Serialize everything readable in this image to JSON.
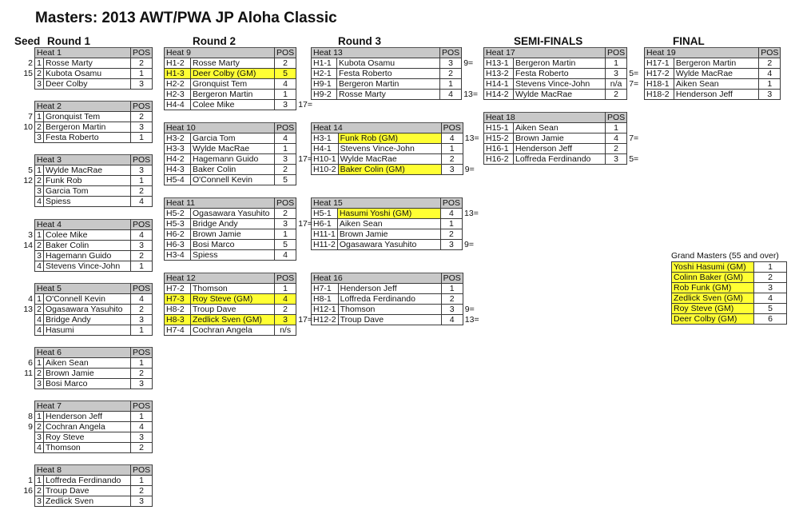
{
  "title": "Masters:  2013 AWT/PWA JP Aloha Classic",
  "headers": {
    "seed": "Seed",
    "round1": "Round 1",
    "round2": "Round 2",
    "round3": "Round 3",
    "semis": "SEMI-FINALS",
    "final": "FINAL"
  },
  "pos_label": "POS",
  "round1": [
    {
      "heat": "Heat 1",
      "rows": [
        {
          "seed": "2",
          "num": "1",
          "name": "Rosse Marty",
          "pos": "2"
        },
        {
          "seed": "15",
          "num": "2",
          "name": "Kubota Osamu",
          "pos": "1"
        },
        {
          "seed": "",
          "num": "3",
          "name": "Deer Colby",
          "pos": "3"
        }
      ]
    },
    {
      "heat": "Heat 2",
      "rows": [
        {
          "seed": "7",
          "num": "1",
          "name": "Gronquist Tem",
          "pos": "2"
        },
        {
          "seed": "10",
          "num": "2",
          "name": "Bergeron Martin",
          "pos": "3"
        },
        {
          "seed": "",
          "num": "3",
          "name": "Festa Roberto",
          "pos": "1"
        }
      ]
    },
    {
      "heat": "Heat 3",
      "rows": [
        {
          "seed": "5",
          "num": "1",
          "name": "Wylde MacRae",
          "pos": "3"
        },
        {
          "seed": "12",
          "num": "2",
          "name": "Funk Rob",
          "pos": "1"
        },
        {
          "seed": "",
          "num": "3",
          "name": "Garcia Tom",
          "pos": "2"
        },
        {
          "seed": "",
          "num": "4",
          "name": "Spiess",
          "pos": "4"
        }
      ]
    },
    {
      "heat": "Heat 4",
      "rows": [
        {
          "seed": "3",
          "num": "1",
          "name": "Colee Mike",
          "pos": "4"
        },
        {
          "seed": "14",
          "num": "2",
          "name": "Baker Colin",
          "pos": "3"
        },
        {
          "seed": "",
          "num": "3",
          "name": "Hagemann Guido",
          "pos": "2"
        },
        {
          "seed": "",
          "num": "4",
          "name": "Stevens Vince-John",
          "pos": "1"
        }
      ]
    },
    {
      "heat": "Heat 5",
      "rows": [
        {
          "seed": "4",
          "num": "1",
          "name": "O'Connell Kevin",
          "pos": "4"
        },
        {
          "seed": "13",
          "num": "2",
          "name": "Ogasawara Yasuhito",
          "pos": "2"
        },
        {
          "seed": "",
          "num": "4",
          "name": "Bridge Andy",
          "pos": "3"
        },
        {
          "seed": "",
          "num": "4",
          "name": "Hasumi",
          "pos": "1"
        }
      ]
    },
    {
      "heat": "Heat 6",
      "rows": [
        {
          "seed": "6",
          "num": "1",
          "name": "Aiken Sean",
          "pos": "1"
        },
        {
          "seed": "11",
          "num": "2",
          "name": "Brown Jamie",
          "pos": "2"
        },
        {
          "seed": "",
          "num": "3",
          "name": "Bosi Marco",
          "pos": "3"
        }
      ]
    },
    {
      "heat": "Heat 7",
      "rows": [
        {
          "seed": "8",
          "num": "1",
          "name": "Henderson Jeff",
          "pos": "1"
        },
        {
          "seed": "9",
          "num": "2",
          "name": "Cochran Angela",
          "pos": "4"
        },
        {
          "seed": "",
          "num": "3",
          "name": "Roy Steve",
          "pos": "3"
        },
        {
          "seed": "",
          "num": "4",
          "name": "Thomson",
          "pos": "2"
        }
      ]
    },
    {
      "heat": "Heat 8",
      "rows": [
        {
          "seed": "1",
          "num": "1",
          "name": "Loffreda Ferdinando",
          "pos": "1"
        },
        {
          "seed": "16",
          "num": "2",
          "name": "Troup Dave",
          "pos": "2"
        },
        {
          "seed": "",
          "num": "3",
          "name": "Zedlick Sven",
          "pos": "3"
        }
      ]
    }
  ],
  "round2": [
    {
      "heat": "Heat 9",
      "rows": [
        {
          "code": "H1-2",
          "name": "Rosse Marty",
          "pos": "2",
          "gm": false,
          "note": ""
        },
        {
          "code": "H1-3",
          "name": "Deer Colby (GM)",
          "pos": "5",
          "gm": true,
          "note": ""
        },
        {
          "code": "H2-2",
          "name": "Gronquist Tem",
          "pos": "4",
          "gm": false,
          "note": ""
        },
        {
          "code": "H2-3",
          "name": "Bergeron Martin",
          "pos": "1",
          "gm": false,
          "note": ""
        },
        {
          "code": "H4-4",
          "name": "Colee Mike",
          "pos": "3",
          "gm": false,
          "note": "17="
        }
      ]
    },
    {
      "heat": "Heat 10",
      "rows": [
        {
          "code": "H3-2",
          "name": "Garcia Tom",
          "pos": "4",
          "gm": false,
          "note": ""
        },
        {
          "code": "H3-3",
          "name": "Wylde MacRae",
          "pos": "1",
          "gm": false,
          "note": ""
        },
        {
          "code": "H4-2",
          "name": "Hagemann Guido",
          "pos": "3",
          "gm": false,
          "note": "17="
        },
        {
          "code": "H4-3",
          "name": "Baker Colin",
          "pos": "2",
          "gm": false,
          "note": ""
        },
        {
          "code": "H5-4",
          "name": "O'Connell Kevin",
          "pos": "5",
          "gm": false,
          "note": ""
        }
      ]
    },
    {
      "heat": "Heat 11",
      "rows": [
        {
          "code": "H5-2",
          "name": "Ogasawara Yasuhito",
          "pos": "2",
          "gm": false,
          "note": ""
        },
        {
          "code": "H5-3",
          "name": "Bridge Andy",
          "pos": "3",
          "gm": false,
          "note": "17="
        },
        {
          "code": "H6-2",
          "name": "Brown Jamie",
          "pos": "1",
          "gm": false,
          "note": ""
        },
        {
          "code": "H6-3",
          "name": "Bosi Marco",
          "pos": "5",
          "gm": false,
          "note": ""
        },
        {
          "code": "H3-4",
          "name": "Spiess",
          "pos": "4",
          "gm": false,
          "note": ""
        }
      ]
    },
    {
      "heat": "Heat 12",
      "rows": [
        {
          "code": "H7-2",
          "name": "Thomson",
          "pos": "1",
          "gm": false,
          "note": ""
        },
        {
          "code": "H7-3",
          "name": "Roy Steve (GM)",
          "pos": "4",
          "gm": true,
          "note": ""
        },
        {
          "code": "H8-2",
          "name": "Troup Dave",
          "pos": "2",
          "gm": false,
          "note": ""
        },
        {
          "code": "H8-3",
          "name": "Zedlick Sven (GM)",
          "pos": "3",
          "gm": true,
          "note": "17="
        },
        {
          "code": "H7-4",
          "name": "Cochran Angela",
          "pos": "n/s",
          "gm": false,
          "note": ""
        }
      ]
    }
  ],
  "round3": [
    {
      "heat": "Heat 13",
      "rows": [
        {
          "code": "H1-1",
          "name": "Kubota Osamu",
          "pos": "3",
          "gm": false,
          "note": "9="
        },
        {
          "code": "H2-1",
          "name": "Festa Roberto",
          "pos": "2",
          "gm": false,
          "note": ""
        },
        {
          "code": "H9-1",
          "name": "Bergeron Martin",
          "pos": "1",
          "gm": false,
          "note": ""
        },
        {
          "code": "H9-2",
          "name": "Rosse Marty",
          "pos": "4",
          "gm": false,
          "note": "13="
        }
      ]
    },
    {
      "heat": "Heat 14",
      "rows": [
        {
          "code": "H3-1",
          "name": "Funk Rob (GM)",
          "pos": "4",
          "gm": true,
          "note": "13="
        },
        {
          "code": "H4-1",
          "name": "Stevens Vince-John",
          "pos": "1",
          "gm": false,
          "note": ""
        },
        {
          "code": "H10-1",
          "name": "Wylde MacRae",
          "pos": "2",
          "gm": false,
          "note": ""
        },
        {
          "code": "H10-2",
          "name": "Baker Colin (GM)",
          "pos": "3",
          "gm": true,
          "note": "9="
        }
      ]
    },
    {
      "heat": "Heat 15",
      "rows": [
        {
          "code": "H5-1",
          "name": "Hasumi Yoshi (GM)",
          "pos": "4",
          "gm": true,
          "note": "13="
        },
        {
          "code": "H6-1",
          "name": "Aiken Sean",
          "pos": "1",
          "gm": false,
          "note": ""
        },
        {
          "code": "H11-1",
          "name": "Brown Jamie",
          "pos": "2",
          "gm": false,
          "note": ""
        },
        {
          "code": "H11-2",
          "name": "Ogasawara Yasuhito",
          "pos": "3",
          "gm": false,
          "note": "9="
        }
      ]
    },
    {
      "heat": "Heat 16",
      "rows": [
        {
          "code": "H7-1",
          "name": "Henderson Jeff",
          "pos": "1",
          "gm": false,
          "note": ""
        },
        {
          "code": "H8-1",
          "name": "Loffreda Ferdinando",
          "pos": "2",
          "gm": false,
          "note": ""
        },
        {
          "code": "H12-1",
          "name": "Thomson",
          "pos": "3",
          "gm": false,
          "note": "9="
        },
        {
          "code": "H12-2",
          "name": "Troup Dave",
          "pos": "4",
          "gm": false,
          "note": "13="
        }
      ]
    }
  ],
  "semis": [
    {
      "heat": "Heat 17",
      "rows": [
        {
          "code": "H13-1",
          "name": "Bergeron Martin",
          "pos": "1",
          "gm": false,
          "note": ""
        },
        {
          "code": "H13-2",
          "name": "Festa Roberto",
          "pos": "3",
          "gm": false,
          "note": "5="
        },
        {
          "code": "H14-1",
          "name": "Stevens Vince-John",
          "pos": "n/a",
          "gm": false,
          "note": "7="
        },
        {
          "code": "H14-2",
          "name": "Wylde MacRae",
          "pos": "2",
          "gm": false,
          "note": ""
        }
      ]
    },
    {
      "heat": "Heat 18",
      "rows": [
        {
          "code": "H15-1",
          "name": "Aiken Sean",
          "pos": "1",
          "gm": false,
          "note": ""
        },
        {
          "code": "H15-2",
          "name": "Brown Jamie",
          "pos": "4",
          "gm": false,
          "note": "7="
        },
        {
          "code": "H16-1",
          "name": "Henderson Jeff",
          "pos": "2",
          "gm": false,
          "note": ""
        },
        {
          "code": "H16-2",
          "name": "Loffreda Ferdinando",
          "pos": "3",
          "gm": false,
          "note": "5="
        }
      ]
    }
  ],
  "final": [
    {
      "heat": "Heat 19",
      "rows": [
        {
          "code": "H17-1",
          "name": "Bergeron Martin",
          "pos": "2",
          "gm": false,
          "note": ""
        },
        {
          "code": "H17-2",
          "name": "Wylde MacRae",
          "pos": "4",
          "gm": false,
          "note": ""
        },
        {
          "code": "H18-1",
          "name": "Aiken Sean",
          "pos": "1",
          "gm": false,
          "note": ""
        },
        {
          "code": "H18-2",
          "name": "Henderson Jeff",
          "pos": "3",
          "gm": false,
          "note": ""
        }
      ]
    }
  ],
  "grand_masters": {
    "title": "Grand Masters (55 and over)",
    "rows": [
      {
        "name": "Yoshi Hasumi  (GM)",
        "pos": "1"
      },
      {
        "name": "Colinn Baker (GM)",
        "pos": "2"
      },
      {
        "name": "Rob Funk (GM)",
        "pos": "3"
      },
      {
        "name": "Zedlick Sven (GM)",
        "pos": "4"
      },
      {
        "name": "Roy Steve (GM)",
        "pos": "5"
      },
      {
        "name": "Deer Colby (GM)",
        "pos": "6"
      }
    ]
  },
  "colors": {
    "header_bg": "#c8c8c8",
    "gm_highlight": "#ffff33"
  }
}
